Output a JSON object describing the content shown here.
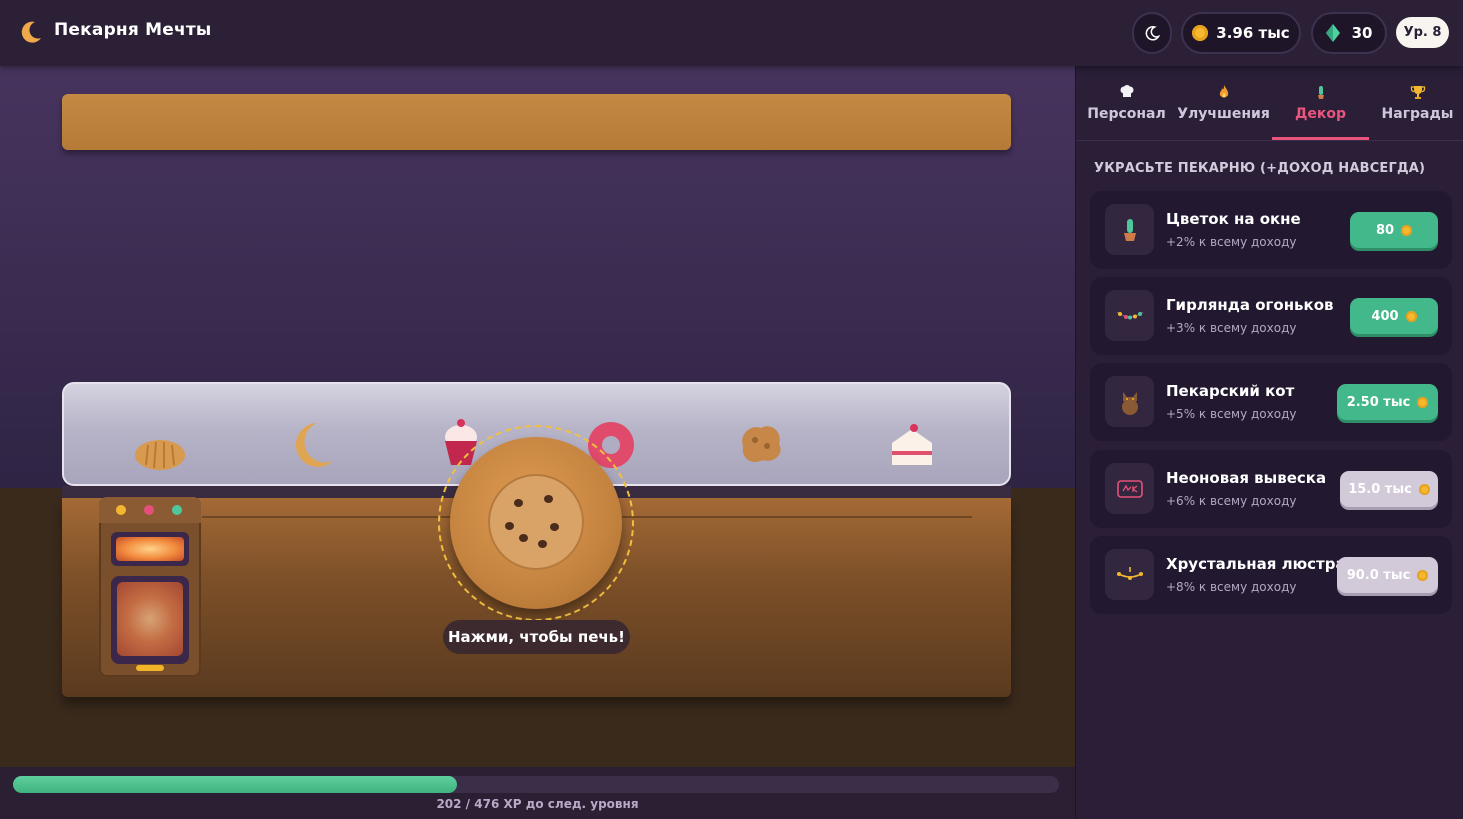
{
  "app": {
    "title": "Пекарня Мечты"
  },
  "header": {
    "coins": "3.96 тыс",
    "gems": "30",
    "level": "Ур. 8"
  },
  "bakery": {
    "bake_prompt": "Нажми, чтобы печь!",
    "xp": {
      "current": 202,
      "target": 476,
      "text": "202 / 476 XP до след. уровня"
    },
    "display_items": [
      "bread-icon",
      "croissant-icon",
      "cupcake-icon",
      "donut-icon",
      "cookie-icon",
      "cake-icon"
    ]
  },
  "sidebar": {
    "tabs": [
      {
        "label": "Персонал",
        "icon": "chef-hat-icon"
      },
      {
        "label": "Улучшения",
        "icon": "flame-icon"
      },
      {
        "label": "Декор",
        "icon": "cactus-icon"
      },
      {
        "label": "Награды",
        "icon": "trophy-icon"
      }
    ],
    "active_tab": "Декор",
    "section_title": "УКРАСЬТЕ ПЕКАРНЮ (+ДОХОД НАВСЕГДА)",
    "items": [
      {
        "name": "Цветок на окне",
        "desc": "+2% к всему доходу",
        "price": "80",
        "affordable": true,
        "icon": "potted-cactus-icon"
      },
      {
        "name": "Гирлянда огоньков",
        "desc": "+3% к всему доходу",
        "price": "400",
        "affordable": true,
        "icon": "string-lights-icon"
      },
      {
        "name": "Пекарский кот",
        "desc": "+5% к всему доходу",
        "price": "2.50 тыс",
        "affordable": true,
        "icon": "cat-icon"
      },
      {
        "name": "Неоновая вывеска",
        "desc": "+6% к всему доходу",
        "price": "15.0 тыс",
        "affordable": false,
        "icon": "neon-sign-icon"
      },
      {
        "name": "Хрустальная люстра",
        "desc": "+8% к всему доходу",
        "price": "90.0 тыс",
        "affordable": false,
        "icon": "chandelier-icon"
      }
    ]
  },
  "colors": {
    "accent": "#e9557d",
    "buy_available": "#43b88a",
    "buy_locked": "#d2c9d9",
    "xp_bar": "#4cc08e",
    "coin": "#f5b82e"
  }
}
